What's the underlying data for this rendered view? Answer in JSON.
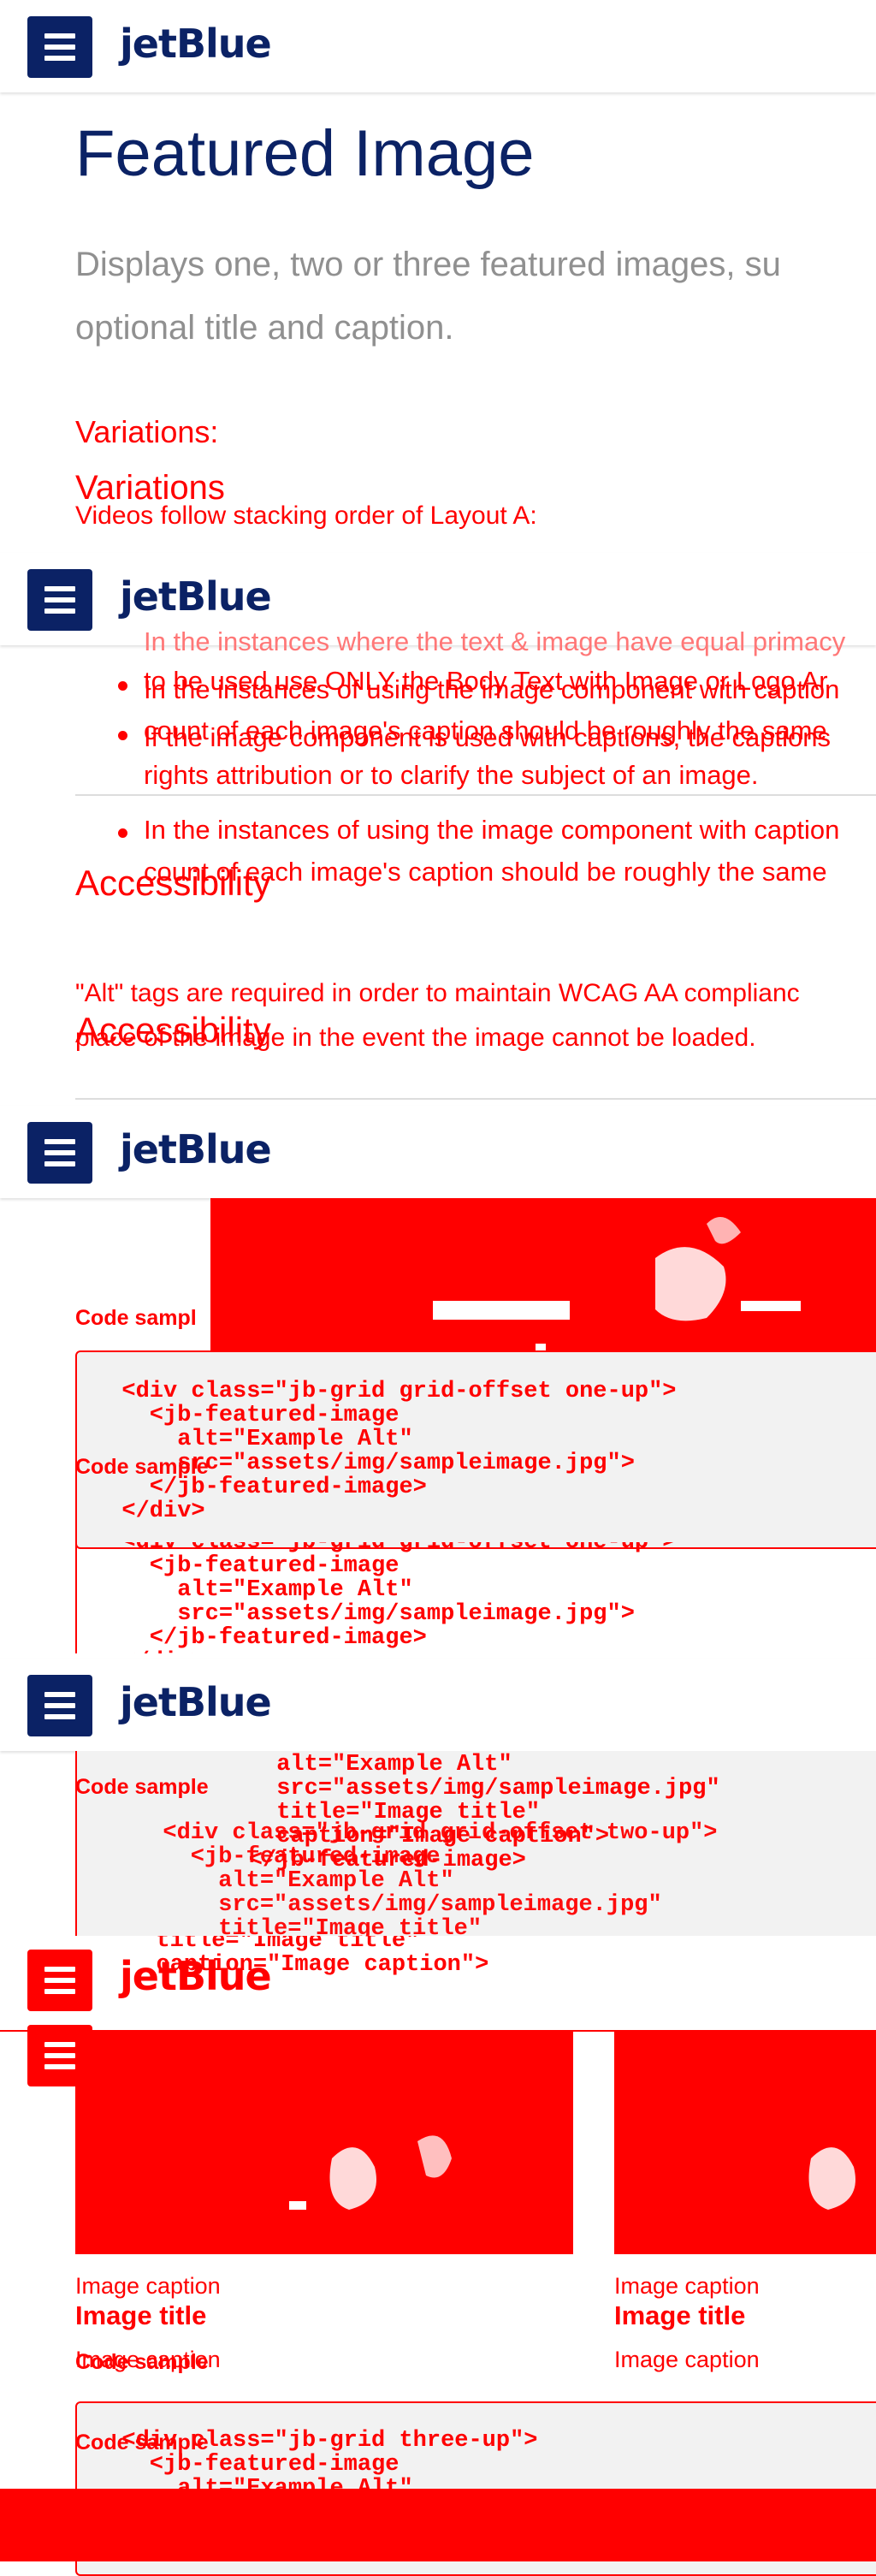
{
  "header": {
    "brand": "jetBlue",
    "menu_label": "Menu"
  },
  "page": {
    "title": "Featured Image",
    "lead_line1": "Displays one, two or three featured images, su",
    "lead_line2": "optional title and caption."
  },
  "variations": {
    "heading": "Variations:",
    "heading_overlay": "Variations",
    "intro": "Videos follow stacking order of Layout A:"
  },
  "guidelines": {
    "item1": "In the instances where the text & image have equal primacy",
    "item2a": "to be used use ONLY the Body Text with Image or Logo Ar",
    "item2b": "In the instances of using the image component with caption",
    "item3a": "count of each image's caption should be roughly the same",
    "item3b": "If the image component is used with captions, the captions",
    "item3c": "rights attribution or to clarify the subject of an image.",
    "item4a": "In the instances of using the image component with caption",
    "item4b": "count of each image's caption should be roughly the same"
  },
  "accessibility": {
    "heading": "Accessibility",
    "text1": "\"Alt\" tags are required in order to maintain WCAG AA complianc",
    "text2": "place of the image in the event the image cannot be loaded."
  },
  "code_samples": {
    "label": "Code sample",
    "label_truncated": "Code sampl",
    "one_up_a": "  <div class=\"jb-grid grid-offset one-up\">\n    <jb-featured-image\n      alt=\"Example Alt\"\n      src=\"assets/img/sampleimage.jpg\">\n    </jb-featured-image>\n  </div>",
    "one_up_b": "  <div class=\"jb-grid grid-offset one-up\">\n    <jb-featured-image\n      alt=\"Example Alt\"\n      src=\"assets/img/sampleimage.jpg\">\n    </jb-featured-image>\n  </div>",
    "two_up_top": "      alt=\"Example Alt\"\n      src=\"assets/img/sampleimage.jpg\"\n      title=\"Image title\"\n      caption=\"Image caption\">\n    </jb-featured-image>",
    "two_up": "  <div class=\"jb-grid grid-offset two-up\">\n    <jb-featured-image\n      alt=\"Example Alt\"\n      src=\"assets/img/sampleimage.jpg\"\n      title=\"Image title\"\n      caption=\"Image caption\">\n    </jb-featured-image>",
    "three_up": "  <div class=\"jb-grid three-up\">\n    <jb-featured-image\n      alt=\"Example Alt\""
  },
  "images": {
    "caption": "Image caption",
    "title": "Image title"
  },
  "colors": {
    "brand_navy": "#0b2265",
    "highlight_red": "#ff0000",
    "lead_gray": "#909090",
    "code_bg": "#f2f2f2"
  }
}
